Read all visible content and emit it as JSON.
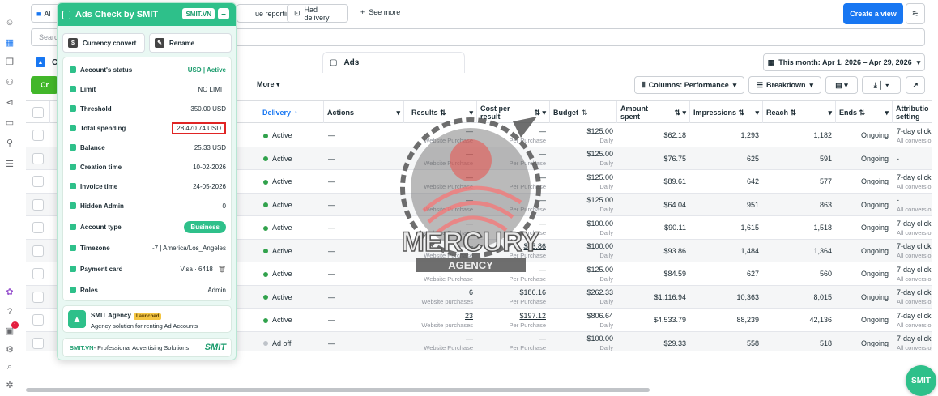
{
  "topbar": {
    "tab_partial": "Al",
    "chip_reporting": "ue reporting",
    "chip_delivery": "Had delivery",
    "see_more": "See more",
    "create_view": "Create a view"
  },
  "search": {
    "placeholder": "Search"
  },
  "tabs": {
    "campaigns_partial": "C",
    "ads": "Ads"
  },
  "date_range": "This month: Apr 1, 2026 – Apr 29, 2026",
  "toolbar": {
    "create": "Cr",
    "more": "More",
    "columns": "Columns: Performance",
    "breakdown": "Breakdown"
  },
  "table": {
    "headers": {
      "delivery": "Delivery",
      "actions": "Actions",
      "results": "Results",
      "cost_line1": "Cost per",
      "cost_line2": "result",
      "budget": "Budget",
      "amount_line1": "Amount",
      "amount_line2": "spent",
      "impressions": "Impressions",
      "reach": "Reach",
      "ends": "Ends",
      "attr_line1": "Attributio",
      "attr_line2": "setting"
    },
    "rows": [
      {
        "delivery": "Active",
        "actions": "—",
        "results": "—",
        "results_sub": "Website Purchase",
        "cost": "—",
        "cost_sub": "Per Purchase",
        "budget": "$125.00",
        "budget_sub": "Daily",
        "spent": "$62.18",
        "impr": "1,293",
        "reach": "1,182",
        "ends": "Ongoing",
        "attr": "7-day click",
        "attr_sub": "All conversio"
      },
      {
        "delivery": "Active",
        "actions": "—",
        "results": "—",
        "results_sub": "Website Purchase",
        "cost": "—",
        "cost_sub": "Per Purchase",
        "budget": "$125.00",
        "budget_sub": "Daily",
        "spent": "$76.75",
        "impr": "625",
        "reach": "591",
        "ends": "Ongoing",
        "attr": "-",
        "attr_sub": ""
      },
      {
        "delivery": "Active",
        "actions": "—",
        "results": "—",
        "results_sub": "Website Purchase",
        "cost": "—",
        "cost_sub": "Per Purchase",
        "budget": "$125.00",
        "budget_sub": "Daily",
        "spent": "$89.61",
        "impr": "642",
        "reach": "577",
        "ends": "Ongoing",
        "attr": "7-day click",
        "attr_sub": "All conversio"
      },
      {
        "delivery": "Active",
        "actions": "—",
        "results": "—",
        "results_sub": "Website Purchase",
        "cost": "—",
        "cost_sub": "Per Purchase",
        "budget": "$125.00",
        "budget_sub": "Daily",
        "spent": "$64.04",
        "impr": "951",
        "reach": "863",
        "ends": "Ongoing",
        "attr": "-",
        "attr_sub": "All conversio"
      },
      {
        "delivery": "Active",
        "actions": "—",
        "results": "—",
        "results_sub": "Website Purchase",
        "cost": "—",
        "cost_sub": "Per Purchase",
        "budget": "$100.00",
        "budget_sub": "Daily",
        "spent": "$90.11",
        "impr": "1,615",
        "reach": "1,518",
        "ends": "Ongoing",
        "attr": "7-day click",
        "attr_sub": "All conversio"
      },
      {
        "delivery": "Active",
        "actions": "—",
        "results": "—",
        "results_sub": "Website Purchase",
        "cost": "$93.86",
        "cost_sub": "Per Purchase",
        "budget": "$100.00",
        "budget_sub": "Daily",
        "spent": "$93.86",
        "impr": "1,484",
        "reach": "1,364",
        "ends": "Ongoing",
        "attr": "7-day click",
        "attr_sub": "All conversio"
      },
      {
        "delivery": "Active",
        "actions": "—",
        "results": "—",
        "results_sub": "Website Purchase",
        "cost": "—",
        "cost_sub": "Per Purchase",
        "budget": "$125.00",
        "budget_sub": "Daily",
        "spent": "$84.59",
        "impr": "627",
        "reach": "560",
        "ends": "Ongoing",
        "attr": "7-day click",
        "attr_sub": "All conversio"
      },
      {
        "delivery": "Active",
        "actions": "—",
        "results": "6",
        "results_sub": "Website purchases",
        "cost": "$186.16",
        "cost_sub": "Per Purchase",
        "budget": "$262.33",
        "budget_sub": "Daily",
        "spent": "$1,116.94",
        "impr": "10,363",
        "reach": "8,015",
        "ends": "Ongoing",
        "attr": "7-day click",
        "attr_sub": "All conversio"
      },
      {
        "delivery": "Active",
        "actions": "—",
        "results": "23",
        "results_sub": "Website purchases",
        "cost": "$197.12",
        "cost_sub": "Per Purchase",
        "budget": "$806.64",
        "budget_sub": "Daily",
        "spent": "$4,533.79",
        "impr": "88,239",
        "reach": "42,136",
        "ends": "Ongoing",
        "attr": "7-day click",
        "attr_sub": "All conversio"
      },
      {
        "delivery": "Ad off",
        "actions": "—",
        "results": "—",
        "results_sub": "Website Purchase",
        "cost": "—",
        "cost_sub": "Per Purchase",
        "budget": "$100.00",
        "budget_sub": "Daily",
        "spent": "$29.33",
        "impr": "558",
        "reach": "518",
        "ends": "Ongoing",
        "attr": "7-day click",
        "attr_sub": "All conversio"
      }
    ]
  },
  "watermark": {
    "line1": "MERCURY",
    "line2": "AGENCY"
  },
  "panel": {
    "title": "Ads Check by SMIT",
    "smit_btn": "SMIT.VN",
    "min_btn": "–",
    "currency_convert": "Currency convert",
    "rename": "Rename",
    "fields": [
      {
        "label": "Account's status",
        "value": "USD | Active"
      },
      {
        "label": "Limit",
        "value": "NO LIMIT"
      },
      {
        "label": "Threshold",
        "value": "350.00 USD"
      },
      {
        "label": "Total spending",
        "value": "28,470.74 USD"
      },
      {
        "label": "Balance",
        "value": "25.33 USD"
      },
      {
        "label": "Creation time",
        "value": "10-02-2026"
      },
      {
        "label": "Invoice time",
        "value": "24-05-2026"
      },
      {
        "label": "Hidden Admin",
        "value": "0"
      },
      {
        "label": "Account type",
        "value": "Business"
      },
      {
        "label": "Timezone",
        "value": "-7 | America/Los_Angeles"
      },
      {
        "label": "Payment card",
        "value": "Visa · 6418"
      },
      {
        "label": "Roles",
        "value": "Admin"
      }
    ],
    "agency_name": "SMIT Agency",
    "agency_badge": "Launched",
    "agency_desc": "Agency solution for renting Ad Accounts",
    "footer_brand": "SMIT.VN",
    "footer_text": " - Professional Advertising Solutions",
    "footer_logo": "SMIT"
  },
  "fab": "SMIT",
  "notification_count": "1",
  "colors": {
    "accent": "#1877f2",
    "smit_green": "#2ec08a",
    "active_green": "#31a24c",
    "highlight_red": "#e02424"
  }
}
